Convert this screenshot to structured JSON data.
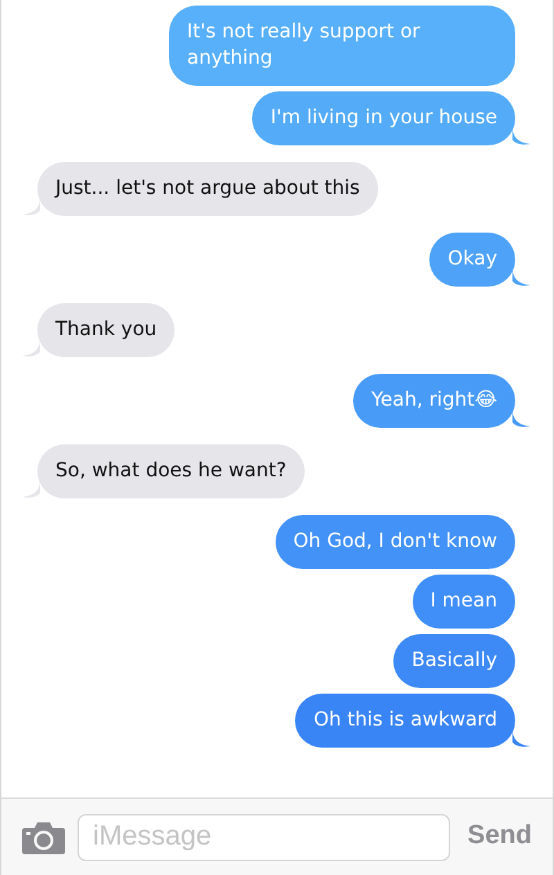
{
  "messages": [
    {
      "kind": "sent",
      "text": "It's not really support or anything",
      "tail": false
    },
    {
      "kind": "sent",
      "text": "I'm living in your house",
      "tail": true
    },
    {
      "kind": "received",
      "text": "Just... let's not argue about this",
      "tail": true
    },
    {
      "kind": "sent",
      "text": "Okay",
      "tail": true
    },
    {
      "kind": "received",
      "text": "Thank you",
      "tail": true
    },
    {
      "kind": "sent",
      "text": "Yeah, right😂",
      "tail": true
    },
    {
      "kind": "received",
      "text": "So, what does he want?",
      "tail": true
    },
    {
      "kind": "sent",
      "text": "Oh God, I don't know",
      "tail": false
    },
    {
      "kind": "sent",
      "text": "I mean",
      "tail": false
    },
    {
      "kind": "sent",
      "text": "Basically",
      "tail": false
    },
    {
      "kind": "sent",
      "text": "Oh this is awkward",
      "tail": true
    }
  ],
  "composer": {
    "placeholder": "iMessage",
    "send": "Send"
  }
}
